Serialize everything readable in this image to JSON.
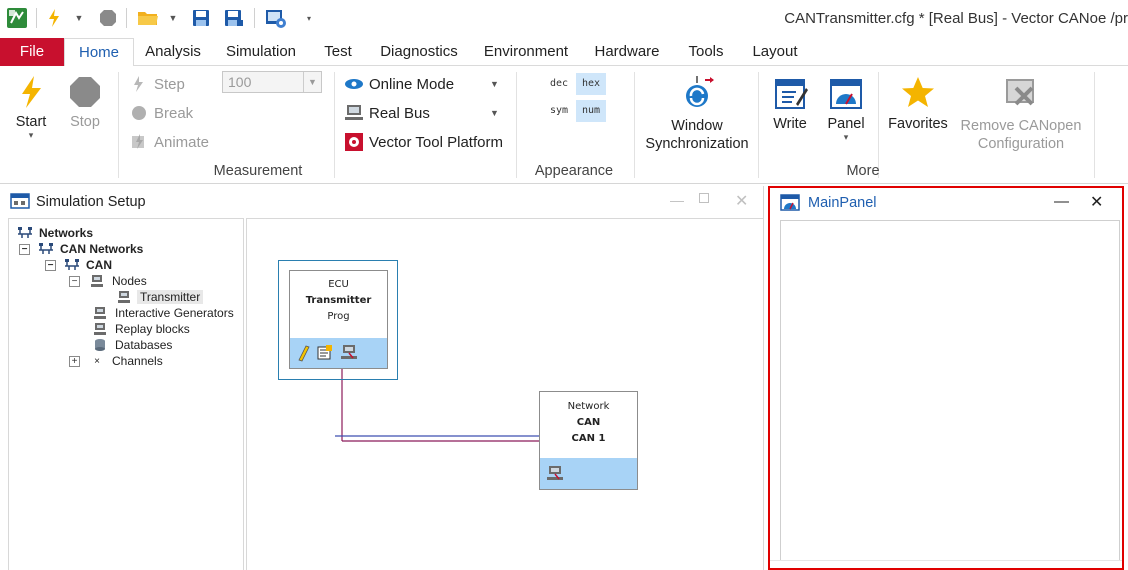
{
  "title_bar": {
    "title": "CANTransmitter.cfg * [Real Bus] - Vector CANoe /pr"
  },
  "menu": {
    "tabs": [
      "File",
      "Home",
      "Analysis",
      "Simulation",
      "Test",
      "Diagnostics",
      "Environment",
      "Hardware",
      "Tools",
      "Layout"
    ],
    "active": "Home"
  },
  "ribbon": {
    "measurement": {
      "label": "Measurement",
      "start": "Start",
      "stop": "Stop",
      "step": "Step",
      "break": "Break",
      "animate": "Animate",
      "step_value": "100",
      "online_mode": "Online Mode",
      "real_bus": "Real Bus",
      "vector_tool_platform": "Vector Tool Platform"
    },
    "appearance": {
      "label": "Appearance",
      "dec": "dec",
      "hex": "hex",
      "sym": "sym",
      "num": "num"
    },
    "more": {
      "label": "More",
      "window_sync_line1": "Window",
      "window_sync_line2": "Synchronization",
      "write": "Write",
      "panel": "Panel",
      "favorites": "Favorites",
      "remove_canopen_line1": "Remove CANopen",
      "remove_canopen_line2": "Configuration"
    }
  },
  "simulation_setup": {
    "title": "Simulation Setup",
    "tree": {
      "networks": "Networks",
      "can_networks": "CAN Networks",
      "can": "CAN",
      "nodes": "Nodes",
      "transmitter": "Transmitter",
      "interactive_generators": "Interactive Generators",
      "replay_blocks": "Replay blocks",
      "databases": "Databases",
      "channels": "Channels"
    },
    "diagram": {
      "ecu_block": {
        "line1": "ECU",
        "line2": "Transmitter",
        "line3": "Prog"
      },
      "network_block": {
        "line1": "Network",
        "line2": "CAN",
        "line3": "CAN 1"
      }
    }
  },
  "main_panel": {
    "title": "MainPanel"
  },
  "colors": {
    "file_tab": "#c8102e",
    "accent_blue": "#1f5fb0",
    "highlight_border": "#e00000",
    "block_strip": "#a8d3f6"
  }
}
